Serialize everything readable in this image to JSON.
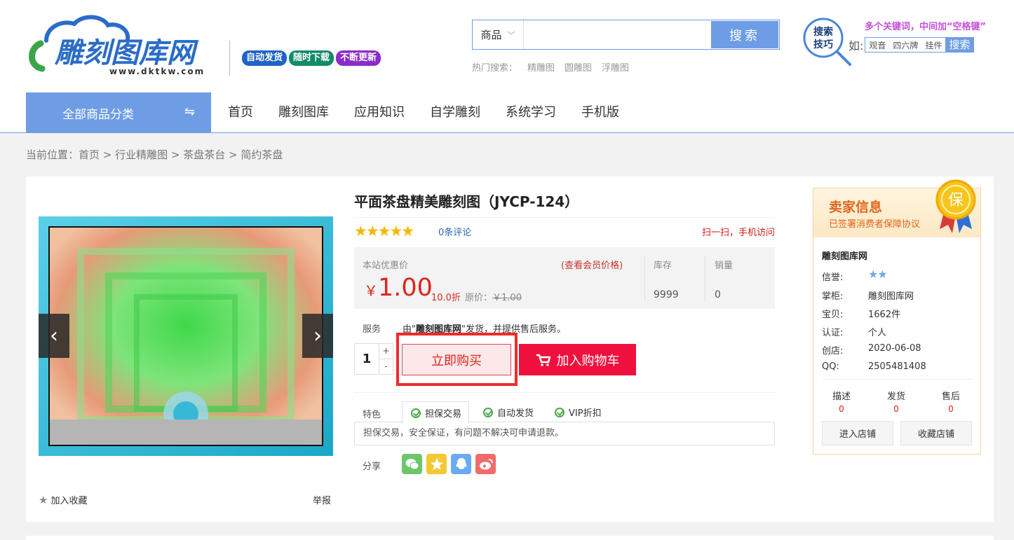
{
  "header": {
    "logo_text": "雕刻图库网",
    "logo_url_text": "www.dktkw.com",
    "badges": [
      "自动发货",
      "随时下载",
      "不断更新"
    ],
    "search": {
      "category": "商品",
      "placeholder": "",
      "button": "搜索",
      "hot_label": "热门搜索：",
      "hot_terms": [
        "精雕图",
        "圆雕图",
        "浮雕图"
      ]
    },
    "tips": {
      "icon_text_1": "搜索",
      "icon_text_2": "技巧",
      "hint": "多个关键词，中间加“空格键”",
      "example_label": "如:",
      "examples": [
        "观音",
        "四六牌",
        "挂件"
      ],
      "button": "搜索"
    }
  },
  "nav": {
    "all_categories": "全部商品分类",
    "items": [
      "首页",
      "雕刻图库",
      "应用知识",
      "自学雕刻",
      "系统学习",
      "手机版"
    ]
  },
  "breadcrumb": {
    "label": "当前位置：",
    "path": [
      "首页",
      "行业精雕图",
      "茶盘茶台",
      "简约茶盘"
    ],
    "sep": " > "
  },
  "product": {
    "title": "平面茶盘精美雕刻图（JYCP-124）",
    "stars": "★★★★★",
    "comments": "0条评论",
    "scan": "扫一扫，手机访问",
    "price_label": "本站优惠价",
    "member_price": "(查看会员价格)",
    "currency": "￥",
    "price": "1.00",
    "discount": "10.0折",
    "orig_label": "原价：",
    "orig_price": "￥1.00",
    "stock_label": "库存",
    "stock": "9999",
    "sales_label": "销量",
    "sales": "0",
    "service_label": "服务",
    "service_prefix": "由\"",
    "service_shop": "雕刻图库网",
    "service_suffix": "\"发货，并提供售后服务。",
    "quantity": "1",
    "qty_plus": "+",
    "qty_minus": "-",
    "buy_now": "立即购买",
    "add_cart": "加入购物车",
    "feature_label": "特色",
    "features": [
      "担保交易",
      "自动发货",
      "VIP折扣"
    ],
    "feature_desc": "担保交易，安全保证，有问题不解决可申请退款。",
    "share_label": "分享",
    "favorite": "加入收藏",
    "report": "举报",
    "gallery_prev": "‹",
    "gallery_next": "›"
  },
  "seller": {
    "title": "卖家信息",
    "subtitle": "已签署消费者保障协议",
    "medal_text": "保",
    "name": "雕刻图库网",
    "rows": [
      {
        "label": "信誉:",
        "value": "★★"
      },
      {
        "label": "掌柜:",
        "value": "雕刻图库网"
      },
      {
        "label": "宝贝:",
        "value": "1662件"
      },
      {
        "label": "认证:",
        "value": "个人"
      },
      {
        "label": "创店:",
        "value": "2020-06-08"
      },
      {
        "label": "QQ:",
        "value": "2505481408"
      }
    ],
    "scores": [
      {
        "label": "描述",
        "value": "0"
      },
      {
        "label": "发货",
        "value": "0"
      },
      {
        "label": "售后",
        "value": "0"
      }
    ],
    "enter_shop": "进入店铺",
    "fav_shop": "收藏店铺"
  },
  "colors": {
    "accent": "#6e9de6",
    "price_red": "#e0231a",
    "cart_red": "#f0103e",
    "seller_orange": "#e1651f",
    "star_gold": "#f6b700"
  }
}
